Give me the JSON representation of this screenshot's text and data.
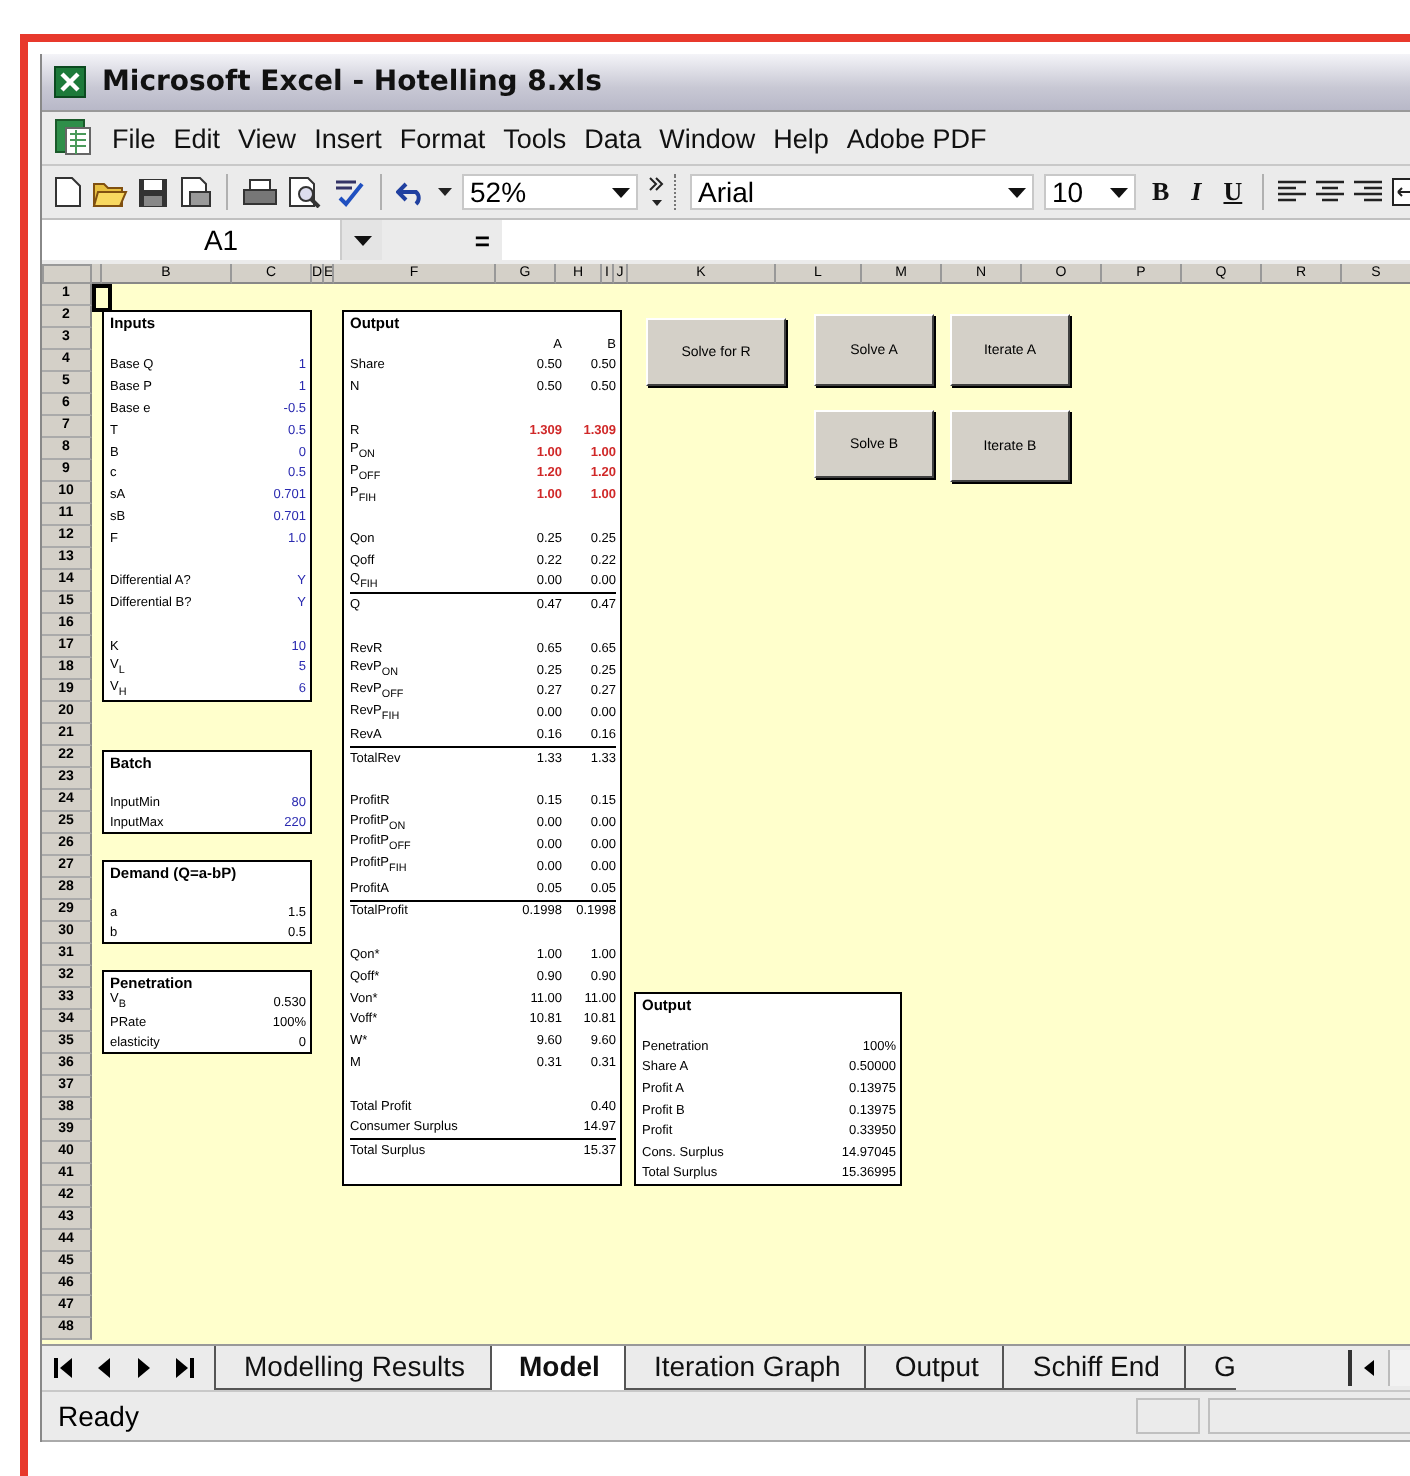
{
  "window": {
    "title": "Microsoft Excel - Hotelling 8.xls"
  },
  "menu": [
    "File",
    "Edit",
    "View",
    "Insert",
    "Format",
    "Tools",
    "Data",
    "Window",
    "Help",
    "Adobe PDF"
  ],
  "toolbar": {
    "zoom": "52%",
    "font": "Arial",
    "size": "10",
    "format_buttons": [
      {
        "label": "B",
        "kind": "bold"
      },
      {
        "label": "I",
        "kind": "italic"
      },
      {
        "label": "U",
        "kind": "underline"
      }
    ]
  },
  "formula_bar": {
    "name_box": "A1",
    "equals": "="
  },
  "sheet": {
    "columns": [
      "B",
      "C",
      "D",
      "E",
      "F",
      "G",
      "H",
      "I",
      "J",
      "K",
      "L",
      "M",
      "N",
      "O",
      "P",
      "Q",
      "R",
      "S"
    ],
    "rows": [
      "1",
      "2",
      "3",
      "4",
      "5",
      "6",
      "7",
      "8",
      "9",
      "10",
      "11",
      "12",
      "13",
      "14",
      "15",
      "16",
      "17",
      "18",
      "19",
      "20",
      "21",
      "22",
      "23",
      "24",
      "25",
      "26",
      "27",
      "28",
      "29",
      "30",
      "31",
      "32",
      "33",
      "34",
      "35",
      "36",
      "37",
      "38",
      "39",
      "40",
      "41",
      "42",
      "43",
      "44",
      "45",
      "46",
      "47",
      "48"
    ]
  },
  "boxes": [
    {
      "title": "Inputs",
      "lines": [
        {
          "kind": "gap"
        },
        {
          "kind": "input",
          "label": "Base Q",
          "values": [
            "1"
          ]
        },
        {
          "kind": "input",
          "label": "Base P",
          "values": [
            "1"
          ]
        },
        {
          "kind": "input",
          "label": "Base e",
          "values": [
            "-0.5"
          ]
        },
        {
          "kind": "input",
          "label": "T",
          "values": [
            "0.5"
          ]
        },
        {
          "kind": "input",
          "label": "B",
          "values": [
            "0"
          ]
        },
        {
          "kind": "input",
          "label": "c",
          "values": [
            "0.5"
          ]
        },
        {
          "kind": "input",
          "label": "sA",
          "values": [
            "0.701"
          ]
        },
        {
          "kind": "input",
          "label": "sB",
          "values": [
            "0.701"
          ]
        },
        {
          "kind": "input",
          "label": "F",
          "values": [
            "1.0"
          ]
        },
        {
          "kind": "gap"
        },
        {
          "kind": "input",
          "label": "Differential A?",
          "values": [
            "Y"
          ]
        },
        {
          "kind": "input",
          "label": "Differential B?",
          "values": [
            "Y"
          ]
        },
        {
          "kind": "gap"
        },
        {
          "kind": "input",
          "label": "K",
          "values": [
            "10"
          ]
        },
        {
          "kind": "input",
          "label": "V$_{L}$",
          "values": [
            "5"
          ]
        },
        {
          "kind": "input",
          "label": "V$_{H}$",
          "values": [
            "6"
          ]
        }
      ]
    },
    {
      "title": "Output",
      "lines": [
        {
          "kind": "head",
          "values": [
            "A",
            "B"
          ]
        },
        {
          "kind": "value",
          "label": "Share",
          "values": [
            "0.50",
            "0.50"
          ]
        },
        {
          "kind": "value",
          "label": "N",
          "values": [
            "0.50",
            "0.50"
          ]
        },
        {
          "kind": "gap"
        },
        {
          "kind": "key",
          "label": "R",
          "values": [
            "1.309",
            "1.309"
          ]
        },
        {
          "kind": "key",
          "label": "P$_{ON}$",
          "values": [
            "1.00",
            "1.00"
          ]
        },
        {
          "kind": "key",
          "label": "P$_{OFF}$",
          "values": [
            "1.20",
            "1.20"
          ]
        },
        {
          "kind": "key",
          "label": "P$_{FIH}$",
          "values": [
            "1.00",
            "1.00"
          ]
        },
        {
          "kind": "gap"
        },
        {
          "kind": "value",
          "label": "Qon",
          "values": [
            "0.25",
            "0.25"
          ]
        },
        {
          "kind": "value",
          "label": "Qoff",
          "values": [
            "0.22",
            "0.22"
          ]
        },
        {
          "kind": "value",
          "label": "Q$_{FIH}$",
          "values": [
            "0.00",
            "0.00"
          ]
        },
        {
          "kind": "sum",
          "label": "Q",
          "values": [
            "0.47",
            "0.47"
          ]
        },
        {
          "kind": "gap"
        },
        {
          "kind": "value",
          "label": "RevR",
          "values": [
            "0.65",
            "0.65"
          ]
        },
        {
          "kind": "value",
          "label": "RevP$_{ON}$",
          "values": [
            "0.25",
            "0.25"
          ]
        },
        {
          "kind": "value",
          "label": "RevP$_{OFF}$",
          "values": [
            "0.27",
            "0.27"
          ]
        },
        {
          "kind": "value",
          "label": "RevP$_{FIH}$",
          "values": [
            "0.00",
            "0.00"
          ]
        },
        {
          "kind": "value",
          "label": "RevA",
          "values": [
            "0.16",
            "0.16"
          ]
        },
        {
          "kind": "sum",
          "label": "TotalRev",
          "values": [
            "1.33",
            "1.33"
          ]
        },
        {
          "kind": "gap"
        },
        {
          "kind": "value",
          "label": "ProfitR",
          "values": [
            "0.15",
            "0.15"
          ]
        },
        {
          "kind": "value",
          "label": "ProfitP$_{ON}$",
          "values": [
            "0.00",
            "0.00"
          ]
        },
        {
          "kind": "value",
          "label": "ProfitP$_{OFF}$",
          "values": [
            "0.00",
            "0.00"
          ]
        },
        {
          "kind": "value",
          "label": "ProfitP$_{FIH}$",
          "values": [
            "0.00",
            "0.00"
          ]
        },
        {
          "kind": "value",
          "label": "ProfitA",
          "values": [
            "0.05",
            "0.05"
          ]
        },
        {
          "kind": "sum",
          "label": "TotalProfit",
          "values": [
            "0.1998",
            "0.1998"
          ]
        },
        {
          "kind": "gap"
        },
        {
          "kind": "value",
          "label": "Qon*",
          "values": [
            "1.00",
            "1.00"
          ]
        },
        {
          "kind": "value",
          "label": "Qoff*",
          "values": [
            "0.90",
            "0.90"
          ]
        },
        {
          "kind": "value",
          "label": "Von*",
          "values": [
            "11.00",
            "11.00"
          ]
        },
        {
          "kind": "value",
          "label": "Voff*",
          "values": [
            "10.81",
            "10.81"
          ]
        },
        {
          "kind": "value",
          "label": "W*",
          "values": [
            "9.60",
            "9.60"
          ]
        },
        {
          "kind": "value",
          "label": "M",
          "values": [
            "0.31",
            "0.31"
          ]
        },
        {
          "kind": "gap"
        },
        {
          "kind": "value",
          "label": "Total Profit",
          "values": [
            "0.40"
          ]
        },
        {
          "kind": "value",
          "label": "Consumer Surplus",
          "values": [
            "14.97"
          ]
        },
        {
          "kind": "sum",
          "label": "Total Surplus",
          "values": [
            "15.37"
          ]
        },
        {
          "kind": "gap"
        }
      ]
    },
    {
      "title": "Batch",
      "lines": [
        {
          "kind": "gap"
        },
        {
          "kind": "input",
          "label": "InputMin",
          "values": [
            "80"
          ]
        },
        {
          "kind": "input",
          "label": "InputMax",
          "values": [
            "220"
          ]
        }
      ]
    },
    {
      "title": "Demand (Q=a-bP)",
      "lines": [
        {
          "kind": "gap"
        },
        {
          "kind": "value",
          "label": "a",
          "values": [
            "1.5"
          ]
        },
        {
          "kind": "value",
          "label": "b",
          "values": [
            "0.5"
          ]
        }
      ]
    },
    {
      "title": "Penetration",
      "lines": [
        {
          "kind": "value",
          "label": "V$_{B}$",
          "values": [
            "0.530"
          ]
        },
        {
          "kind": "value",
          "label": "PRate",
          "values": [
            "100%"
          ]
        },
        {
          "kind": "value",
          "label": "elasticity",
          "values": [
            "0"
          ]
        }
      ]
    },
    {
      "title": "Output",
      "lines": [
        {
          "kind": "gap"
        },
        {
          "kind": "value",
          "label": "Penetration",
          "values": [
            "100%"
          ]
        },
        {
          "kind": "value",
          "label": "Share A",
          "values": [
            "0.50000"
          ]
        },
        {
          "kind": "value",
          "label": "Profit A",
          "values": [
            "0.13975"
          ]
        },
        {
          "kind": "value",
          "label": "Profit B",
          "values": [
            "0.13975"
          ]
        },
        {
          "kind": "value",
          "label": "Profit",
          "values": [
            "0.33950"
          ]
        },
        {
          "kind": "value",
          "label": "Cons. Surplus",
          "values": [
            "14.97045"
          ]
        },
        {
          "kind": "value",
          "label": "Total Surplus",
          "values": [
            "15.36995"
          ]
        }
      ]
    }
  ],
  "buttons": [
    "Solve for R",
    "Solve A",
    "Iterate A",
    "Solve B",
    "Iterate B"
  ],
  "sheet_tabs": [
    {
      "label": "Modelling Results",
      "selected": false
    },
    {
      "label": "Model",
      "selected": true
    },
    {
      "label": "Iteration Graph",
      "selected": false
    },
    {
      "label": "Output",
      "selected": false
    },
    {
      "label": "Schiff End",
      "selected": false
    },
    {
      "label": "G",
      "selected": false
    }
  ],
  "status_bar": {
    "text": "Ready"
  }
}
